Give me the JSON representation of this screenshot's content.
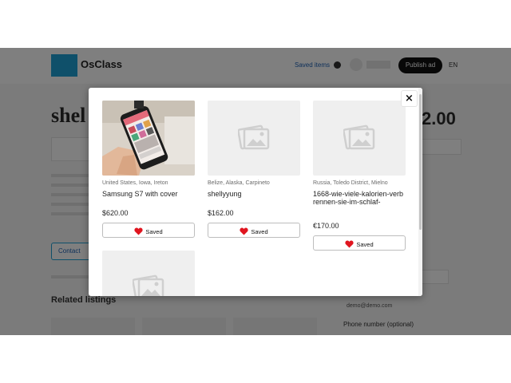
{
  "background_page": {
    "brand": "OsClass",
    "header": {
      "saved_items_label": "Saved items",
      "publish_button": "Publish ad",
      "language": "EN"
    },
    "listing_title": "shel",
    "listing_price": "2.00",
    "contact_button": "Contact",
    "related_heading": "Related listings",
    "contact_email": "demo@demo.com",
    "phone_label": "Phone number (optional)"
  },
  "modal": {
    "close_glyph": "×",
    "items": [
      {
        "location": "United States, Iowa, Ireton",
        "title": "Samsung S7 with cover",
        "price": "$620.00",
        "saved_label": "Saved",
        "image": "phone-photo"
      },
      {
        "location": "Belize, Alaska, Carpineto",
        "title": "shellyyung",
        "price": "$162.00",
        "saved_label": "Saved",
        "image": "placeholder-icon"
      },
      {
        "location": "Russia, Toledo District, Mielno",
        "title": "1668-wie-viele-kalorien-verbrennen-sie-im-schlaf-",
        "price": "€170.00",
        "saved_label": "Saved",
        "image": "placeholder-icon"
      },
      {
        "location": "",
        "title": "",
        "price": "",
        "saved_label": "",
        "image": "placeholder-icon"
      }
    ]
  },
  "colors": {
    "heart": "#e0151f",
    "accent": "#1ea0d4",
    "overlay": "rgba(0,0,0,0.5)"
  }
}
